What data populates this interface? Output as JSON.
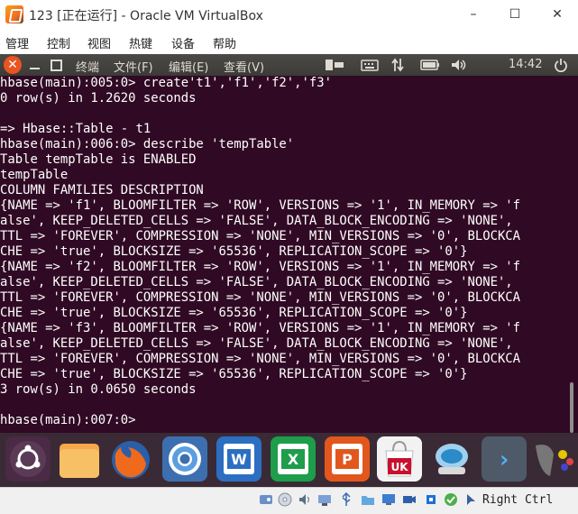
{
  "window": {
    "title": "123 [正在运行] - Oracle VM VirtualBox",
    "controls": {
      "minimize": "–",
      "maximize": "☐",
      "close": "✕"
    }
  },
  "host_menu": [
    "管理",
    "控制",
    "视图",
    "热键",
    "设备",
    "帮助"
  ],
  "guest_topbar": {
    "close_glyph": "✕",
    "menus": [
      "终端",
      "文件(F)",
      "编辑(E)",
      "查看(V)"
    ],
    "clock": "14:42",
    "indicators": [
      "terminal-launcher-icon",
      "keyboard-icon",
      "network-icon",
      "battery-icon",
      "volume-icon",
      "power-icon"
    ]
  },
  "terminal": {
    "lines": [
      "hbase(main):005:0> create't1','f1','f2','f3'",
      "0 row(s) in 1.2620 seconds",
      "",
      "=> Hbase::Table - t1",
      "hbase(main):006:0> describe 'tempTable'",
      "Table tempTable is ENABLED",
      "tempTable",
      "COLUMN FAMILIES DESCRIPTION",
      "{NAME => 'f1', BLOOMFILTER => 'ROW', VERSIONS => '1', IN_MEMORY => 'f",
      "alse', KEEP_DELETED_CELLS => 'FALSE', DATA_BLOCK_ENCODING => 'NONE',",
      "TTL => 'FOREVER', COMPRESSION => 'NONE', MIN_VERSIONS => '0', BLOCKCA",
      "CHE => 'true', BLOCKSIZE => '65536', REPLICATION_SCOPE => '0'}",
      "{NAME => 'f2', BLOOMFILTER => 'ROW', VERSIONS => '1', IN_MEMORY => 'f",
      "alse', KEEP_DELETED_CELLS => 'FALSE', DATA_BLOCK_ENCODING => 'NONE',",
      "TTL => 'FOREVER', COMPRESSION => 'NONE', MIN_VERSIONS => '0', BLOCKCA",
      "CHE => 'true', BLOCKSIZE => '65536', REPLICATION_SCOPE => '0'}",
      "{NAME => 'f3', BLOOMFILTER => 'ROW', VERSIONS => '1', IN_MEMORY => 'f",
      "alse', KEEP_DELETED_CELLS => 'FALSE', DATA_BLOCK_ENCODING => 'NONE',",
      "TTL => 'FOREVER', COMPRESSION => 'NONE', MIN_VERSIONS => '0', BLOCKCA",
      "CHE => 'true', BLOCKSIZE => '65536', REPLICATION_SCOPE => '0'}",
      "3 row(s) in 0.0650 seconds",
      "",
      "hbase(main):007:0> "
    ]
  },
  "dock": {
    "items": [
      "ubuntu-dash-icon",
      "files-icon",
      "firefox-icon",
      "chromium-icon",
      "writer-icon",
      "calc-icon",
      "impress-icon",
      "software-center-icon",
      "remote-desktop-icon",
      "terminal-icon",
      "more-apps-icon"
    ],
    "labels": {
      "writer": "W",
      "calc": "X",
      "impress": "P",
      "software": "UK",
      "terminal": "›"
    }
  },
  "statusbar": {
    "icons": [
      "storage-icon",
      "optical-drive-icon",
      "audio-icon",
      "network-adapter-icon",
      "usb-icon",
      "shared-folders-icon",
      "display-icon",
      "video-capture-icon",
      "cpu-icon",
      "guest-additions-icon",
      "mouse-integration-icon"
    ],
    "host_key": "Right Ctrl"
  },
  "colors": {
    "terminal_bg": "#300a24",
    "terminal_fg": "#ffffff",
    "ubuntu_orange": "#e95420",
    "topbar_bg": "#3c3b37"
  }
}
